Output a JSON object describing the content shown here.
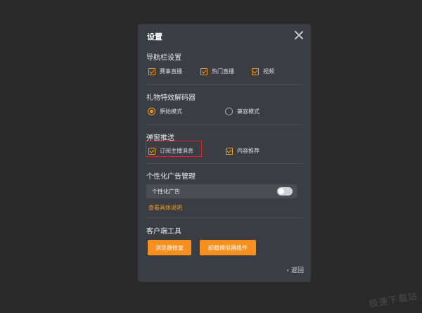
{
  "dialog": {
    "title": "设置",
    "back_label": "‹ 返回"
  },
  "nav_section": {
    "title": "导航栏设置",
    "options": [
      {
        "label": "赛事直播",
        "checked": true
      },
      {
        "label": "热门直播",
        "checked": true
      },
      {
        "label": "视频",
        "checked": true
      }
    ]
  },
  "gift_section": {
    "title": "礼物特效解码器",
    "options": [
      {
        "label": "原始模式",
        "selected": true
      },
      {
        "label": "兼容模式",
        "selected": false
      }
    ]
  },
  "popup_section": {
    "title": "弹窗推送",
    "options": [
      {
        "label": "订阅主播消息",
        "checked": true
      },
      {
        "label": "内容推荐",
        "checked": true
      }
    ]
  },
  "ad_section": {
    "title": "个性化广告管理",
    "toggle_label": "个性化广告",
    "toggle_on": false,
    "link_text": "查看具体说明"
  },
  "client_section": {
    "title": "客户端工具",
    "buttons": [
      "浏览器修复",
      "卸载模拟器组件"
    ]
  },
  "colors": {
    "accent": "#f29a1d",
    "panel_bg": "#3a3d43",
    "page_bg": "#2a2a2b",
    "highlight": "#e02020"
  },
  "icons": [
    "close-icon",
    "checkbox-checked-icon",
    "radio-selected-icon",
    "radio-unselected-icon",
    "chevron-left-icon"
  ],
  "watermark": "极速下载站"
}
